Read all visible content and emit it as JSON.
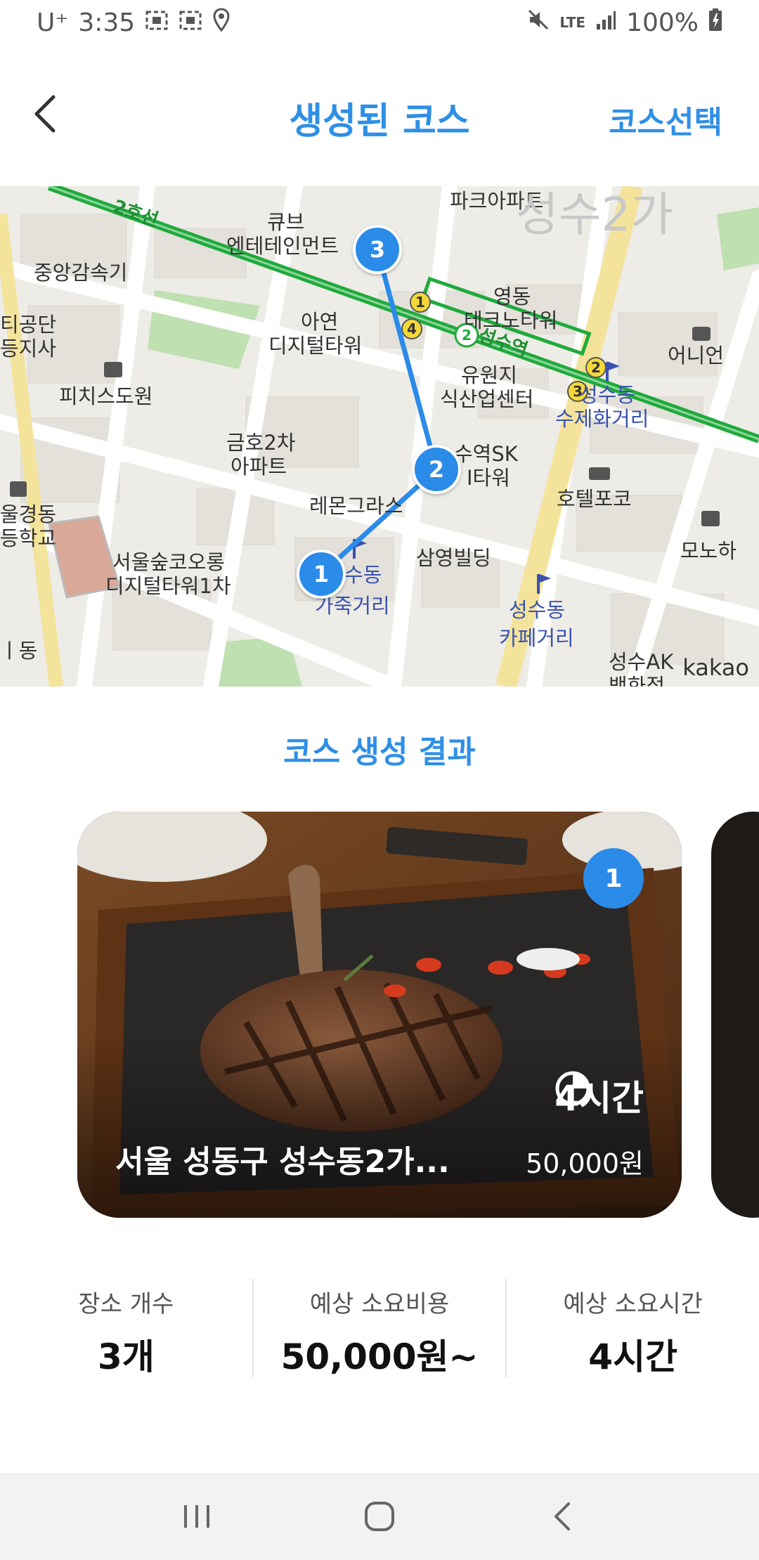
{
  "status_bar": {
    "carrier": "U⁺",
    "time": "3:35",
    "network": "LTE",
    "battery": "100%"
  },
  "header": {
    "title": "생성된 코스",
    "action_label": "코스선택"
  },
  "map": {
    "labels": {
      "line2": "2호선",
      "park_apt": "파크아파트",
      "q_ent": "큐브",
      "q_ent2": "엔테테인먼트",
      "seongsu2ga": "성수2가",
      "jungang": "중앙감속기",
      "yeongdong": "영동",
      "yeongdong2": "테크노타워",
      "ayeon": "아연",
      "ayeon2": "디지털타워",
      "seongsu_station": "성수역",
      "ernion": "어니언",
      "gongdan": "티공단",
      "gongdan2": "등지사",
      "pichis": "피치스도원",
      "yuwon": "유원지",
      "yuwon2": "식산업센터",
      "seongsudong": "성수동",
      "sujehwa": "수제화거리",
      "geumho": "금호2차",
      "geumho2": "아파트",
      "sk": "수역SK",
      "sk2": "I타워",
      "remon": "레몬그라스",
      "hotel": "호텔포코",
      "school": "울경동",
      "school2": "등학교",
      "monoha": "모노하",
      "samyoung": "삼영빌딩",
      "forest": "서울숲코오롱",
      "forest2": "디지털타워1차",
      "leather": "수동",
      "leather2": "가죽거리",
      "cafe": "성수동",
      "cafe2": "카페거리",
      "ak": "성수AK",
      "ak2": "백화점",
      "dong": "ㅣ동"
    },
    "credit": "kakao",
    "markers": [
      "1",
      "2",
      "3"
    ]
  },
  "section_title": "코스 생성 결과",
  "cards": [
    {
      "badge": "1",
      "duration": "4시간",
      "address": "서울 성동구 성수동2가...",
      "price": "50,000원"
    }
  ],
  "stats": [
    {
      "label": "장소 개수",
      "value": "3개"
    },
    {
      "label": "예상 소요비용",
      "value": "50,000원~"
    },
    {
      "label": "예상 소요시간",
      "value": "4시간"
    }
  ],
  "colors": {
    "accent": "#2f8fe6",
    "marker": "#2b8be8",
    "subway_line2": "#1faa3c"
  }
}
